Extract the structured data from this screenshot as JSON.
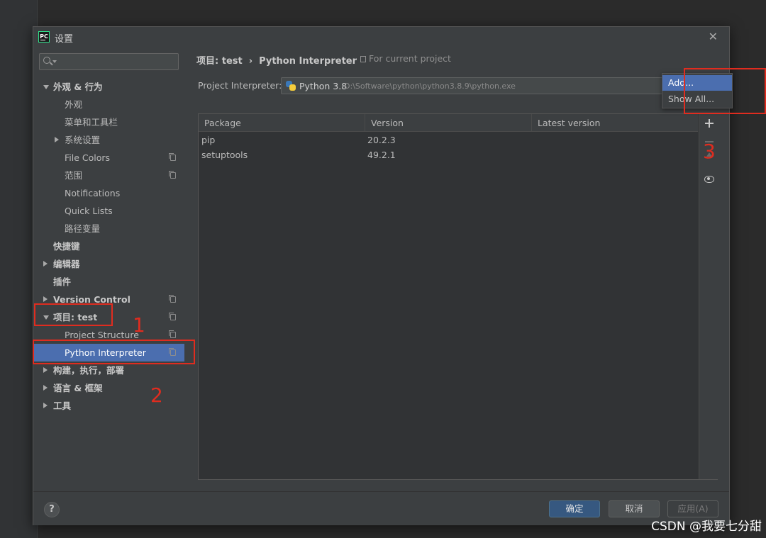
{
  "window": {
    "title": "设置",
    "app_logo_text": "PC",
    "close_glyph": "✕"
  },
  "sidebar": {
    "search_placeholder": "",
    "items": [
      {
        "label": "外观 & 行为",
        "level": 0,
        "arrow": "down",
        "bold": true,
        "copy": false
      },
      {
        "label": "外观",
        "level": 1,
        "arrow": "",
        "bold": false,
        "copy": false
      },
      {
        "label": "菜单和工具栏",
        "level": 1,
        "arrow": "",
        "bold": false,
        "copy": false
      },
      {
        "label": "系统设置",
        "level": 1,
        "arrow": "right",
        "bold": false,
        "copy": false
      },
      {
        "label": "File Colors",
        "level": 1,
        "arrow": "",
        "bold": false,
        "copy": true
      },
      {
        "label": "范围",
        "level": 1,
        "arrow": "",
        "bold": false,
        "copy": true
      },
      {
        "label": "Notifications",
        "level": 1,
        "arrow": "",
        "bold": false,
        "copy": false
      },
      {
        "label": "Quick Lists",
        "level": 1,
        "arrow": "",
        "bold": false,
        "copy": false
      },
      {
        "label": "路径变量",
        "level": 1,
        "arrow": "",
        "bold": false,
        "copy": false
      },
      {
        "label": "快捷键",
        "level": 0,
        "arrow": "",
        "bold": true,
        "copy": false
      },
      {
        "label": "编辑器",
        "level": 0,
        "arrow": "right",
        "bold": true,
        "copy": false
      },
      {
        "label": "插件",
        "level": 0,
        "arrow": "",
        "bold": true,
        "copy": false
      },
      {
        "label": "Version Control",
        "level": 0,
        "arrow": "right",
        "bold": true,
        "copy": true
      },
      {
        "label": "项目: test",
        "level": 0,
        "arrow": "down",
        "bold": true,
        "copy": true
      },
      {
        "label": "Project Structure",
        "level": 1,
        "arrow": "",
        "bold": false,
        "copy": true
      },
      {
        "label": "Python Interpreter",
        "level": 1,
        "arrow": "",
        "bold": false,
        "copy": true,
        "selected": true
      },
      {
        "label": "构建，执行，部署",
        "level": 0,
        "arrow": "right",
        "bold": true,
        "copy": false
      },
      {
        "label": "语言 & 框架",
        "level": 0,
        "arrow": "right",
        "bold": true,
        "copy": false
      },
      {
        "label": "工具",
        "level": 0,
        "arrow": "right",
        "bold": true,
        "copy": false
      }
    ]
  },
  "content": {
    "breadcrumb": [
      "项目: test",
      "Python Interpreter"
    ],
    "breadcrumb_sep": "›",
    "for_current_project": "For current project",
    "interpreter_label": "Project Interpreter:",
    "interpreter_name": "Python 3.8",
    "interpreter_path": "D:\\Software\\python\\python3.8.9\\python.exe",
    "gear_menu": [
      "Add...",
      "Show All..."
    ],
    "table": {
      "columns": [
        "Package",
        "Version",
        "Latest version"
      ],
      "rows": [
        [
          "pip",
          "20.2.3",
          ""
        ],
        [
          "setuptools",
          "49.2.1",
          ""
        ]
      ]
    }
  },
  "footer": {
    "help": "?",
    "ok": "确定",
    "cancel": "取消",
    "apply": "应用(A)"
  },
  "annotations": [
    "1",
    "2",
    "3"
  ],
  "watermark": "CSDN @我要七分甜",
  "colors": {
    "selection": "#4b6eaf",
    "annotation": "#e02c1f",
    "ok_button": "#365880"
  }
}
